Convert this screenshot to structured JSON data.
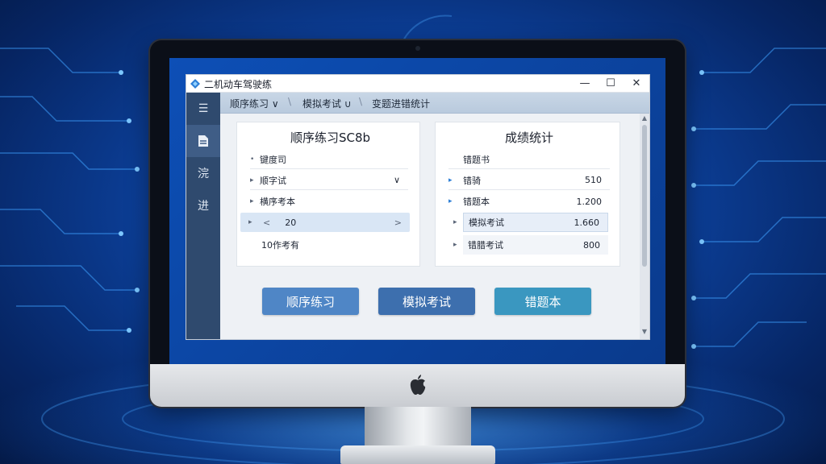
{
  "window": {
    "title": "二机动车驾驶练",
    "minimize": "—",
    "maximize": "☐",
    "close": "✕"
  },
  "sidebar": {
    "items": [
      {
        "icon": "list-icon",
        "glyph": "☰"
      },
      {
        "icon": "document-icon",
        "glyph": "▤"
      },
      {
        "icon": "settings-icon",
        "glyph": "浣"
      },
      {
        "icon": "progress-icon",
        "glyph": "进"
      }
    ]
  },
  "tabs": [
    {
      "label": "顺序练习 ∨"
    },
    {
      "label": "模拟考试 ∪"
    },
    {
      "label": "变题进错统计"
    }
  ],
  "practice_panel": {
    "title": "顺序练习SC8b",
    "rows": [
      {
        "label": "键度司"
      },
      {
        "label": "顺字试",
        "suffix": "∨"
      },
      {
        "label": "横序考本"
      },
      {
        "prefix": "<",
        "label": "20",
        "suffix": ">"
      },
      {
        "label": "10作考有"
      }
    ]
  },
  "stats_panel": {
    "title": "成绩统计",
    "header": "错题书",
    "rows": [
      {
        "label": "错骑",
        "value": "510"
      },
      {
        "label": "错题本",
        "value": "1.200"
      },
      {
        "label": "模拟考试",
        "value": "1.660"
      },
      {
        "label": "错腊考试",
        "value": "800"
      }
    ]
  },
  "buttons": [
    {
      "label": "顺序练习",
      "color": "#4f86c6"
    },
    {
      "label": "模拟考试",
      "color": "#3d6fae"
    },
    {
      "label": "错题本",
      "color": "#3a97c0"
    }
  ],
  "colors": {
    "sidebar": "#2f4a6e",
    "accent": "#4f86c6"
  }
}
